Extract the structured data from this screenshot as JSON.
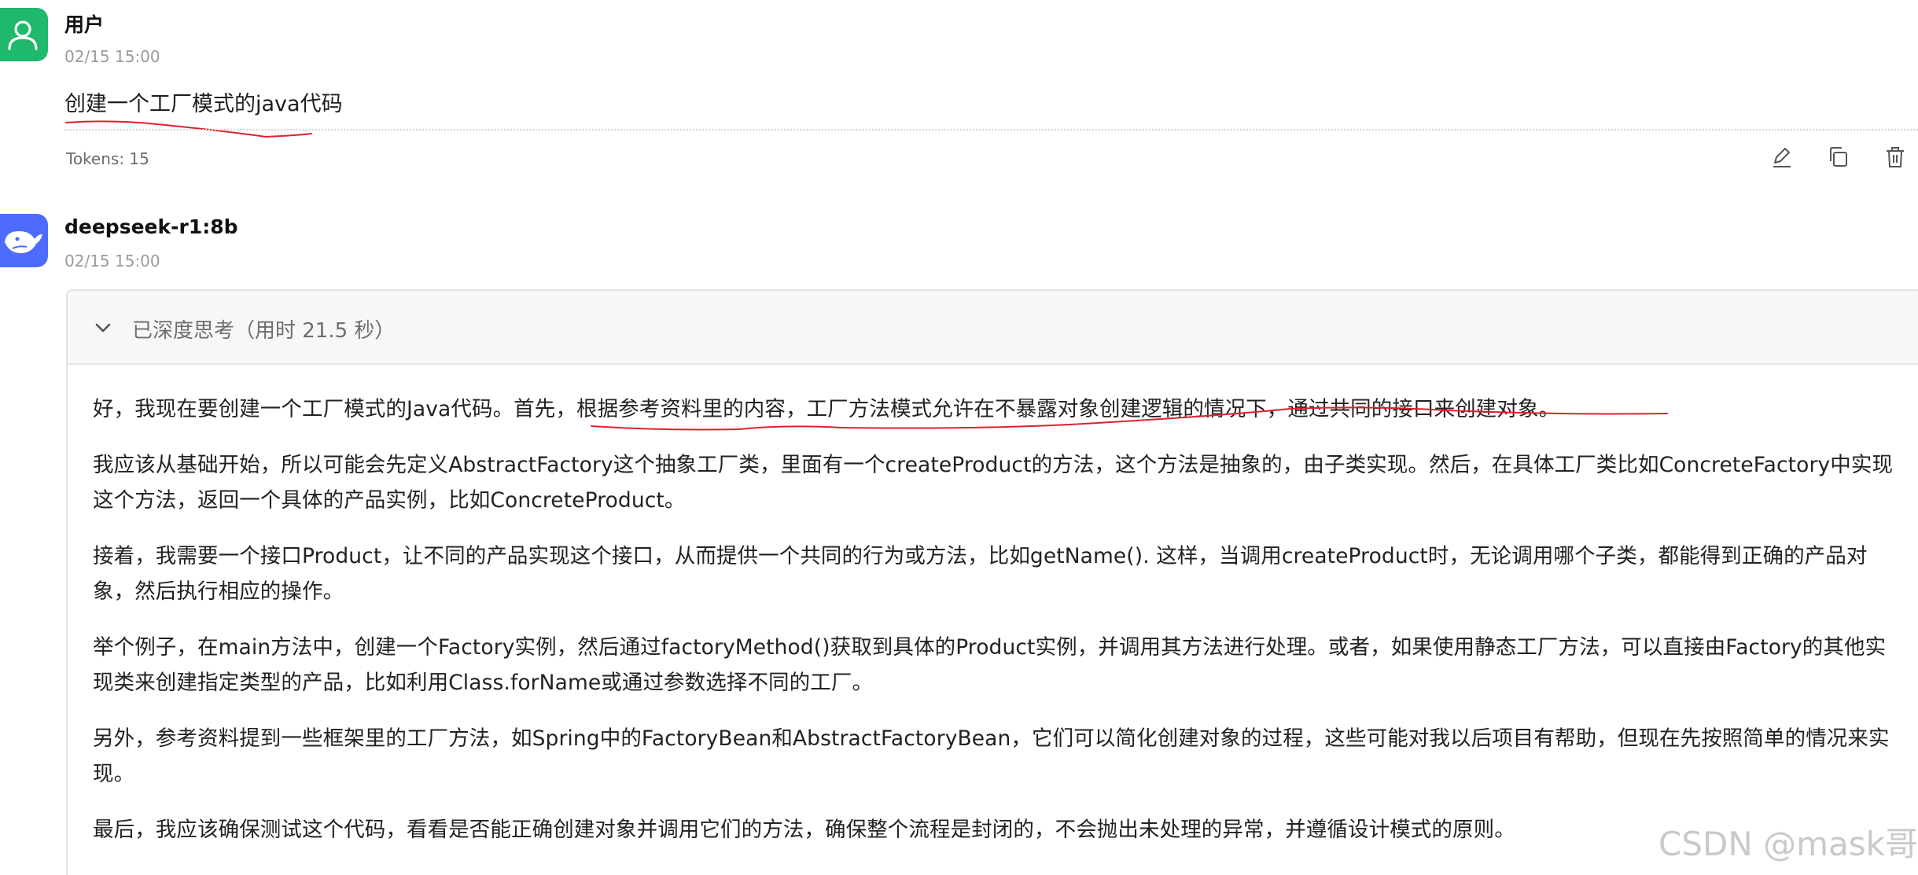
{
  "user_message": {
    "avatar_icon": "user-icon",
    "sender": "用户",
    "time": "02/15 15:00",
    "text": "创建一个工厂模式的java代码",
    "tokens": "Tokens: 15",
    "actions": [
      "edit-icon",
      "copy-icon",
      "delete-icon"
    ]
  },
  "bot_message": {
    "avatar_icon": "deepseek-whale-icon",
    "sender": "deepseek-r1:8b",
    "time": "02/15 15:00",
    "thinking": {
      "title": "已深度思考（用时 21.5 秒）",
      "paragraphs": [
        "好，我现在要创建一个工厂模式的Java代码。首先，根据参考资料里的内容，工厂方法模式允许在不暴露对象创建逻辑的情况下，通过共同的接口来创建对象。",
        "我应该从基础开始，所以可能会先定义AbstractFactory这个抽象工厂类，里面有一个createProduct的方法，这个方法是抽象的，由子类实现。然后，在具体工厂类比如ConcreteFactory中实现这个方法，返回一个具体的产品实例，比如ConcreteProduct。",
        "接着，我需要一个接口Product，让不同的产品实现这个接口，从而提供一个共同的行为或方法，比如getName(). 这样，当调用createProduct时，无论调用哪个子类，都能得到正确的产品对象，然后执行相应的操作。",
        "举个例子，在main方法中，创建一个Factory实例，然后通过factoryMethod()获取到具体的Product实例，并调用其方法进行处理。或者，如果使用静态工厂方法，可以直接由Factory的其他实现类来创建指定类型的产品，比如利用Class.forName或通过参数选择不同的工厂。",
        "另外，参考资料提到一些框架里的工厂方法，如Spring中的FactoryBean和AbstractFactoryBean，它们可以简化创建对象的过程，这些可能对我以后项目有帮助，但现在先按照简单的情况来实现。",
        "最后，我应该确保测试这个代码，看看是否能正确创建对象并调用它们的方法，确保整个流程是封闭的，不会抛出未处理的异常，并遵循设计模式的原则。"
      ]
    }
  },
  "watermark": "CSDN @mask哥",
  "colors": {
    "user_avatar": "#1fb86c",
    "bot_avatar": "#4d6bfe",
    "annotation": "#e0202c"
  }
}
